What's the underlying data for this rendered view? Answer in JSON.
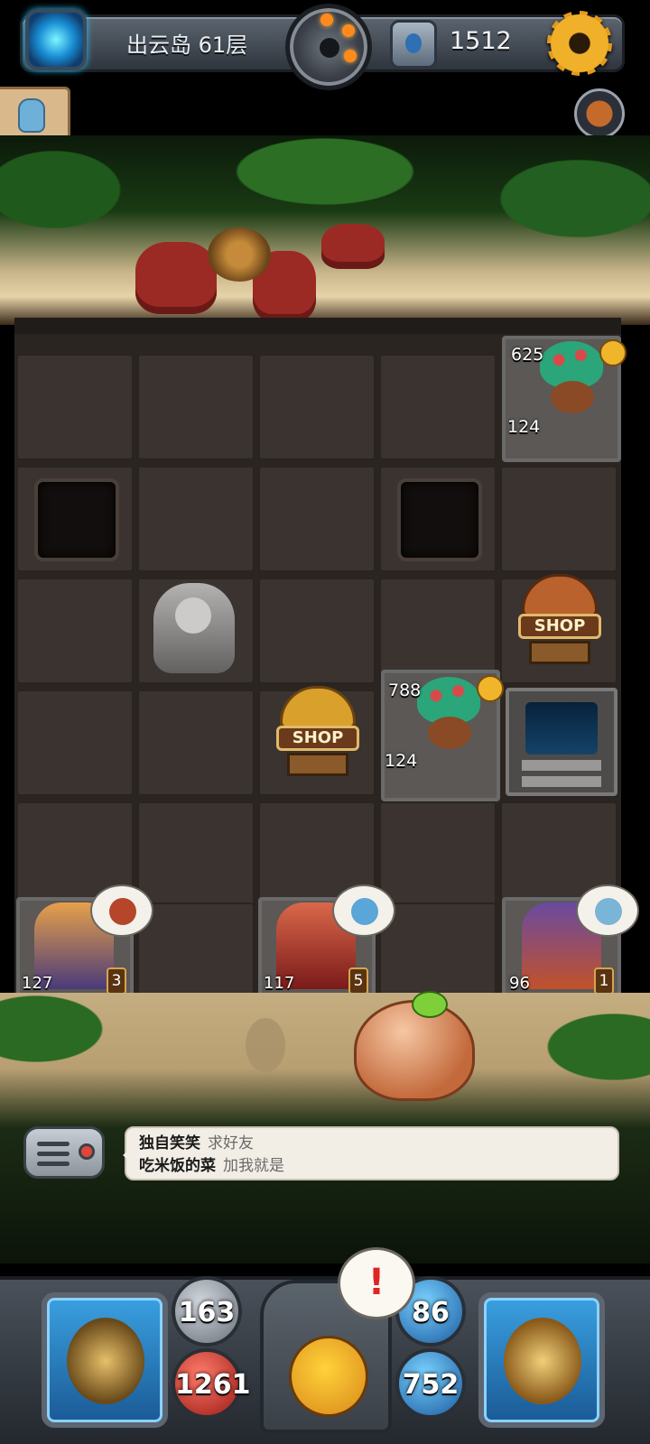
{
  "topbar": {
    "floor_label": "出云岛 61层",
    "coins": "1512",
    "icons": [
      "portal-icon",
      "bomb-dial-icon",
      "rune-icon",
      "gear-icon"
    ]
  },
  "side": {
    "badge_icon": "robot-icon",
    "timer_icon": "timer-icon"
  },
  "board": {
    "monsters": [
      {
        "name": "spider-crab-monster",
        "hp": "625",
        "attack": "124"
      },
      {
        "name": "spider-crab-monster",
        "hp": "788",
        "attack": "124"
      }
    ],
    "shops": [
      {
        "label": "SHOP"
      },
      {
        "label": "SHOP"
      }
    ],
    "heroes": [
      {
        "name": "wolf-warrior",
        "attack": "127",
        "level": "3",
        "bubble_icon": "ember-icon"
      },
      {
        "name": "monkey-swordsman",
        "attack": "117",
        "level": "5",
        "bubble_icon": "whirlwind-icon"
      },
      {
        "name": "owl-knight",
        "attack": "96",
        "level": "1",
        "bubble_icon": "shield-icon"
      }
    ]
  },
  "chat": {
    "lines": [
      {
        "name": "独自笑笑",
        "message": "求好友"
      },
      {
        "name": "吃米饭的菜",
        "message": "加我就是"
      }
    ]
  },
  "hud": {
    "left_attack": "163",
    "left_hp": "1261",
    "right_defense": "86",
    "right_mana": "752",
    "alert": "!"
  },
  "colors": {
    "accent_gold": "#f1b52b",
    "hp_red": "#c22222",
    "mana_blue": "#1a5aa0"
  }
}
